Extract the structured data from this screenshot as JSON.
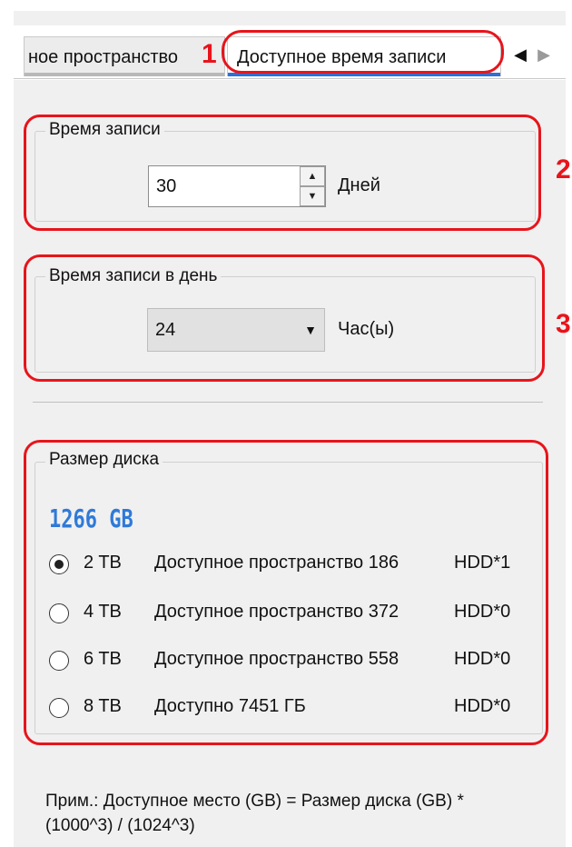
{
  "tabs": [
    {
      "label": "ное пространство",
      "active": false
    },
    {
      "label": "Доступное время записи",
      "active": true
    }
  ],
  "tab_nav": {
    "prev_icon": "arrow-left",
    "next_icon": "arrow-right"
  },
  "annotations": [
    "1",
    "2",
    "3"
  ],
  "record_time": {
    "title": "Время записи",
    "value": "30",
    "unit": "Дней"
  },
  "record_per_day": {
    "title": "Время записи в день",
    "value": "24",
    "unit": "Час(ы)"
  },
  "disk": {
    "title": "Размер диска",
    "size_display": "1266 GB",
    "options": [
      {
        "size": "2 TB",
        "desc": "Доступное пространство 186",
        "hdd": "HDD*1",
        "checked": true
      },
      {
        "size": "4 TB",
        "desc": "Доступное пространство 372",
        "hdd": "HDD*0",
        "checked": false
      },
      {
        "size": "6 TB",
        "desc": "Доступное пространство 558",
        "hdd": "HDD*0",
        "checked": false
      },
      {
        "size": "8 TB",
        "desc": "Доступно 7451 ГБ",
        "hdd": "HDD*0",
        "checked": false
      }
    ]
  },
  "note": "Прим.: Доступное место (GB) = Размер диска (GB) * (1000^3) / (1024^3)",
  "colors": {
    "annotation": "#e8141b",
    "accent": "#2e6fd8",
    "disk_size": "#2f7ad8"
  }
}
